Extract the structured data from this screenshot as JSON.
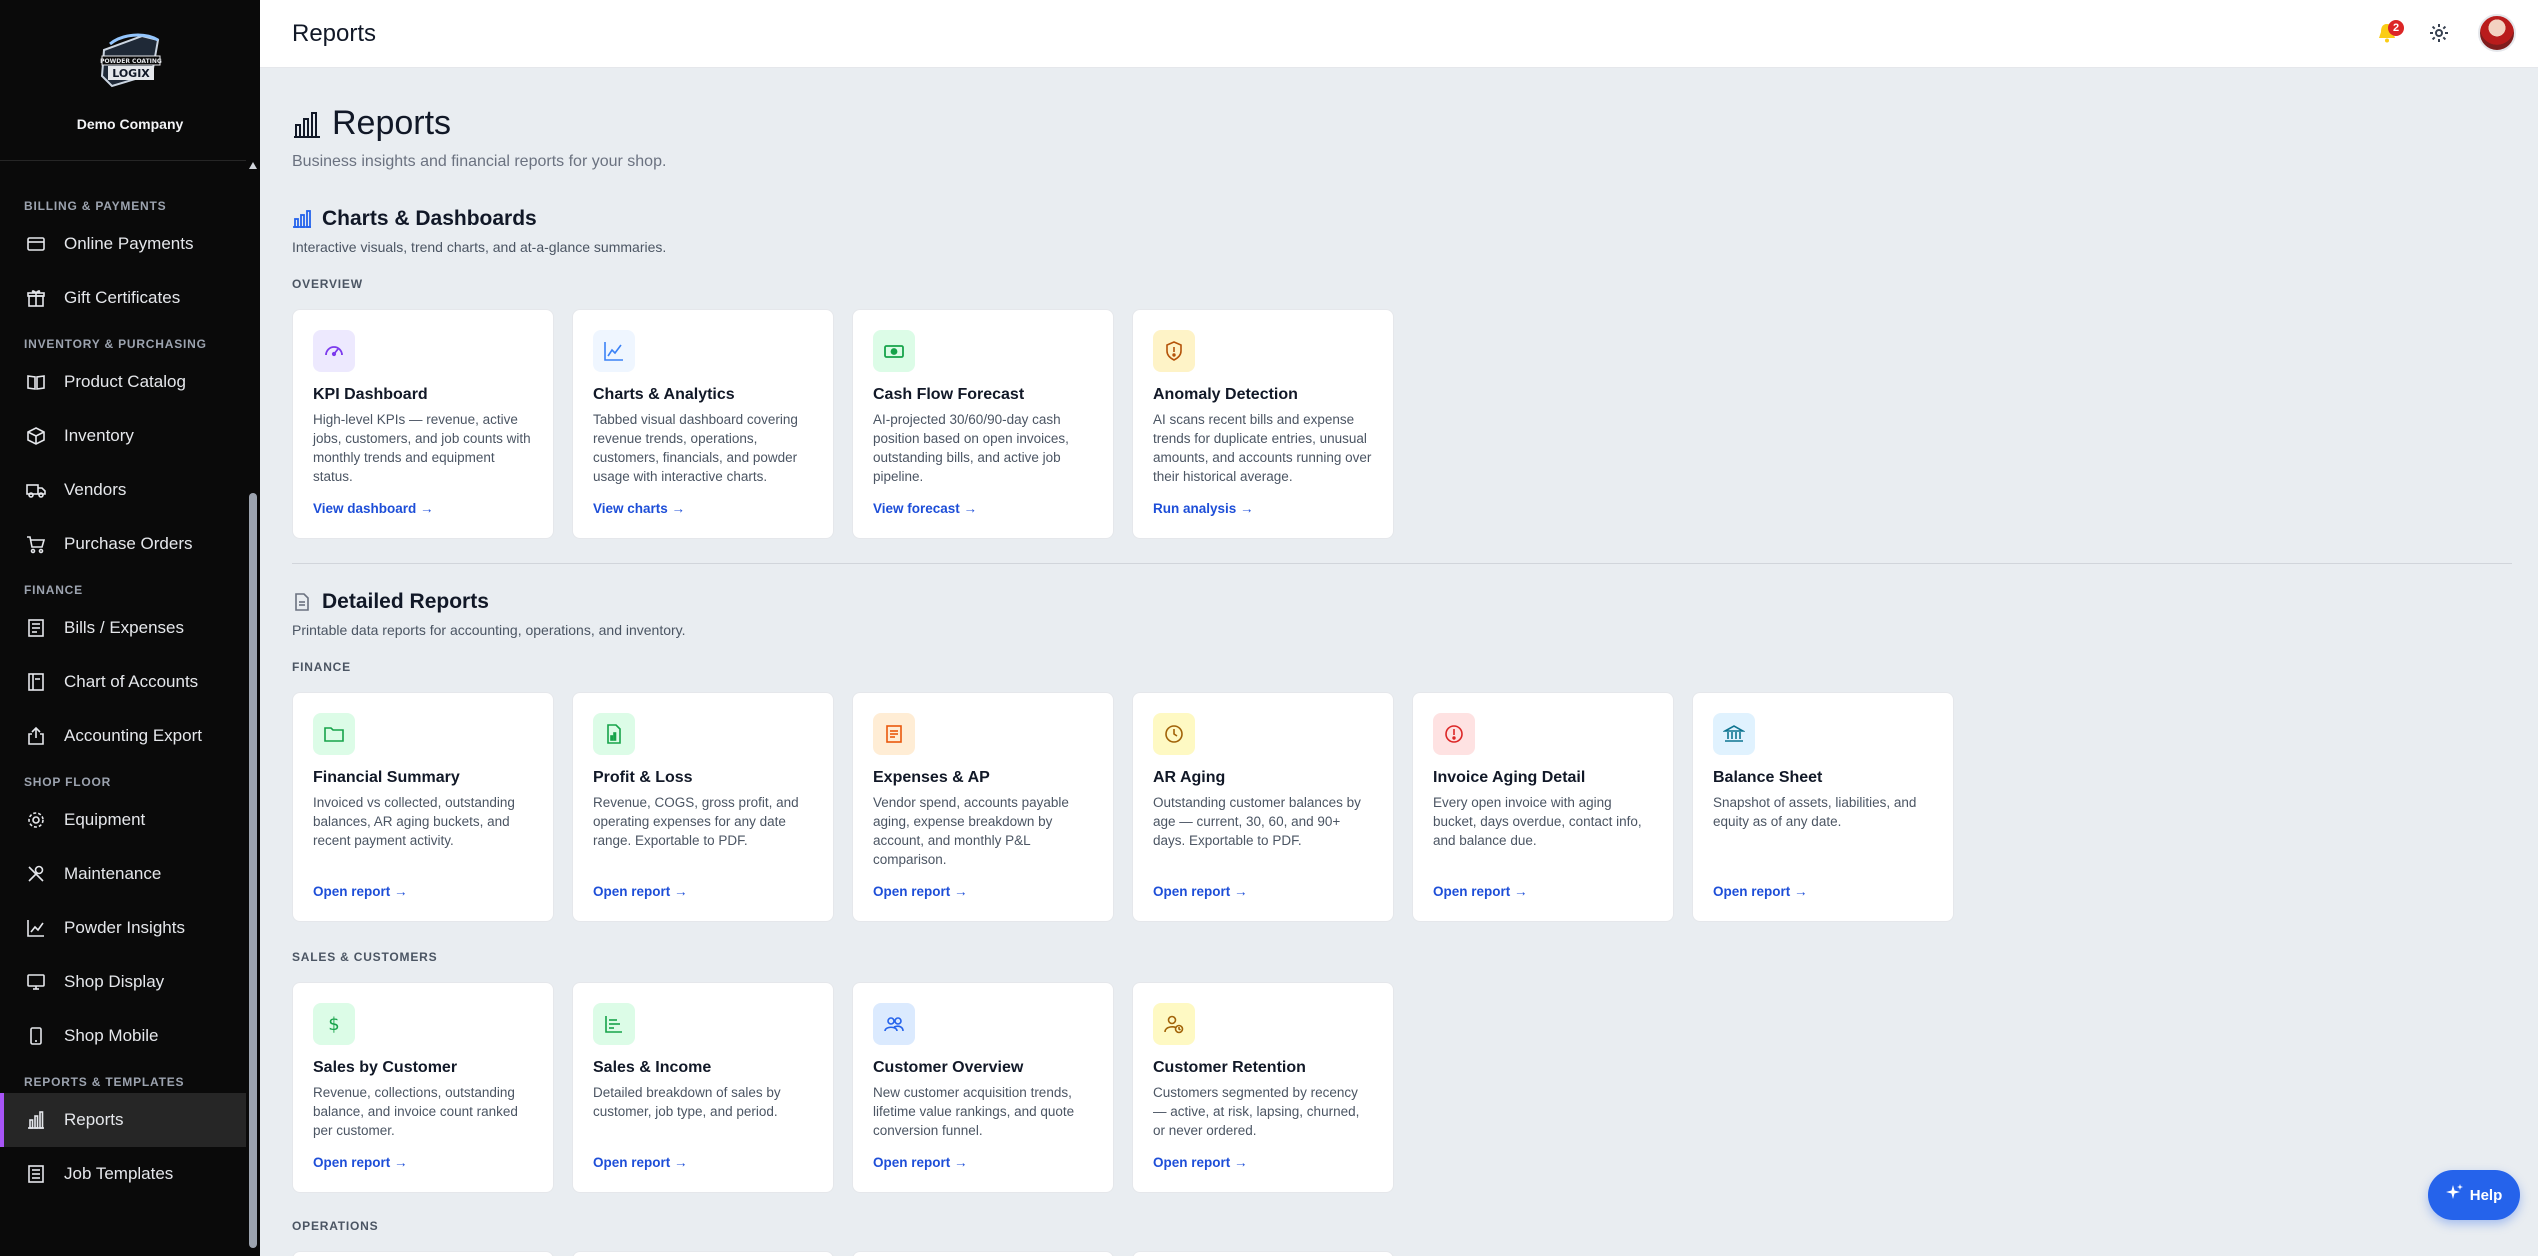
{
  "app": {
    "company": "Demo Company",
    "logo_text": "POWDER COATING LOGIX",
    "page_title": "Reports",
    "notifications_count": "2",
    "help_label": "Help"
  },
  "sidebar": {
    "sections": [
      {
        "title": "BILLING & PAYMENTS",
        "items": [
          {
            "label": "Online Payments",
            "icon": "credit-card-icon"
          },
          {
            "label": "Gift Certificates",
            "icon": "gift-icon"
          }
        ]
      },
      {
        "title": "INVENTORY & PURCHASING",
        "items": [
          {
            "label": "Product Catalog",
            "icon": "book-open-icon"
          },
          {
            "label": "Inventory",
            "icon": "box-icon"
          },
          {
            "label": "Vendors",
            "icon": "truck-icon"
          },
          {
            "label": "Purchase Orders",
            "icon": "cart-icon"
          }
        ]
      },
      {
        "title": "FINANCE",
        "items": [
          {
            "label": "Bills / Expenses",
            "icon": "receipt-icon"
          },
          {
            "label": "Chart of Accounts",
            "icon": "ledger-icon"
          },
          {
            "label": "Accounting Export",
            "icon": "export-icon"
          }
        ]
      },
      {
        "title": "SHOP FLOOR",
        "items": [
          {
            "label": "Equipment",
            "icon": "gear-icon"
          },
          {
            "label": "Maintenance",
            "icon": "wrench-icon"
          },
          {
            "label": "Powder Insights",
            "icon": "trend-icon"
          },
          {
            "label": "Shop Display",
            "icon": "monitor-icon"
          },
          {
            "label": "Shop Mobile",
            "icon": "phone-icon"
          }
        ]
      },
      {
        "title": "REPORTS & TEMPLATES",
        "items": [
          {
            "label": "Reports",
            "icon": "bar-chart-icon",
            "active": true
          },
          {
            "label": "Job Templates",
            "icon": "template-icon"
          }
        ]
      }
    ]
  },
  "main": {
    "title": "Reports",
    "subtitle": "Business insights and financial reports for your shop.",
    "charts_section": {
      "title": "Charts & Dashboards",
      "subtitle": "Interactive visuals, trend charts, and at-a-glance summaries.",
      "group": "OVERVIEW",
      "cards": [
        {
          "title": "KPI Dashboard",
          "desc": "High-level KPIs — revenue, active jobs, customers, and job counts with monthly trends and equipment status.",
          "link": "View dashboard →",
          "icon": "gauge-icon",
          "color": "#7c3aed",
          "bg": "#ede9fe"
        },
        {
          "title": "Charts & Analytics",
          "desc": "Tabbed visual dashboard covering revenue trends, operations, customers, financials, and powder usage with interactive charts.",
          "link": "View charts →",
          "icon": "line-chart-icon",
          "color": "#3b82f6",
          "bg": "#eff6ff"
        },
        {
          "title": "Cash Flow Forecast",
          "desc": "AI-projected 30/60/90-day cash position based on open invoices, outstanding bills, and active job pipeline.",
          "link": "View forecast →",
          "icon": "cash-icon",
          "color": "#16a34a",
          "bg": "#dcfce7"
        },
        {
          "title": "Anomaly Detection",
          "desc": "AI scans recent bills and expense trends for duplicate entries, unusual amounts, and accounts running over their historical average.",
          "link": "Run analysis →",
          "icon": "shield-alert-icon",
          "color": "#d97706",
          "bg": "#fef3c7"
        }
      ]
    },
    "detailed_section": {
      "title": "Detailed Reports",
      "subtitle": "Printable data reports for accounting, operations, and inventory.",
      "finance_group": "FINANCE",
      "finance_cards": [
        {
          "title": "Financial Summary",
          "desc": "Invoiced vs collected, outstanding balances, AR aging buckets, and recent payment activity.",
          "link": "Open report →",
          "icon": "folder-icon",
          "color": "#16a34a",
          "bg": "#dcfce7"
        },
        {
          "title": "Profit & Loss",
          "desc": "Revenue, COGS, gross profit, and operating expenses for any date range. Exportable to PDF.",
          "link": "Open report →",
          "icon": "file-chart-icon",
          "color": "#16a34a",
          "bg": "#dcfce7"
        },
        {
          "title": "Expenses & AP",
          "desc": "Vendor spend, accounts payable aging, expense breakdown by account, and monthly P&L comparison.",
          "link": "Open report →",
          "icon": "receipt-icon",
          "color": "#ea580c",
          "bg": "#ffedd5"
        },
        {
          "title": "AR Aging",
          "desc": "Outstanding customer balances by age — current, 30, 60, and 90+ days. Exportable to PDF.",
          "link": "Open report →",
          "icon": "clock-icon",
          "color": "#ca8a04",
          "bg": "#fef9c3"
        },
        {
          "title": "Invoice Aging Detail",
          "desc": "Every open invoice with aging bucket, days overdue, contact info, and balance due.",
          "link": "Open report →",
          "icon": "alert-circle-icon",
          "color": "#dc2626",
          "bg": "#fee2e2"
        },
        {
          "title": "Balance Sheet",
          "desc": "Snapshot of assets, liabilities, and equity as of any date.",
          "link": "Open report →",
          "icon": "bank-icon",
          "color": "#0e7490",
          "bg": "#e0f2fe"
        }
      ],
      "sales_group": "SALES & CUSTOMERS",
      "sales_cards": [
        {
          "title": "Sales by Customer",
          "desc": "Revenue, collections, outstanding balance, and invoice count ranked per customer.",
          "link": "Open report →",
          "icon": "dollar-icon",
          "color": "#16a34a",
          "bg": "#dcfce7"
        },
        {
          "title": "Sales & Income",
          "desc": "Detailed breakdown of sales by customer, job type, and period.",
          "link": "Open report →",
          "icon": "list-bars-icon",
          "color": "#16a34a",
          "bg": "#dcfce7"
        },
        {
          "title": "Customer Overview",
          "desc": "New customer acquisition trends, lifetime value rankings, and quote conversion funnel.",
          "link": "Open report →",
          "icon": "users-icon",
          "color": "#2563eb",
          "bg": "#dbeafe"
        },
        {
          "title": "Customer Retention",
          "desc": "Customers segmented by recency — active, at risk, lapsing, churned, or never ordered.",
          "link": "Open report →",
          "icon": "user-clock-icon",
          "color": "#a16207",
          "bg": "#fef9c3"
        }
      ],
      "operations_group": "OPERATIONS"
    }
  }
}
